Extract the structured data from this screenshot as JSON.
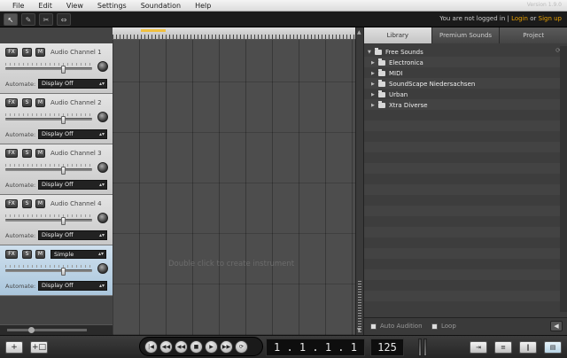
{
  "menu": {
    "items": [
      "File",
      "Edit",
      "View",
      "Settings",
      "Soundation",
      "Help"
    ],
    "version": "Version 1.9.0"
  },
  "toolbar": {
    "tools": [
      "pointer-tool-icon",
      "pencil-tool-icon",
      "split-tool-icon",
      "stretch-tool-icon"
    ],
    "login_text": "You are not logged in |",
    "login_link": "Login",
    "or_text": "or",
    "signup_link": "Sign up"
  },
  "channels": [
    {
      "fx": "FX",
      "solo": "S",
      "mute": "M",
      "name": "Audio Channel 1",
      "automate_label": "Automate:",
      "automate_value": "Display Off",
      "volume": 0.67
    },
    {
      "fx": "FX",
      "solo": "S",
      "mute": "M",
      "name": "Audio Channel 2",
      "automate_label": "Automate:",
      "automate_value": "Display Off",
      "volume": 0.67
    },
    {
      "fx": "FX",
      "solo": "S",
      "mute": "M",
      "name": "Audio Channel 3",
      "automate_label": "Automate:",
      "automate_value": "Display Off",
      "volume": 0.67
    },
    {
      "fx": "FX",
      "solo": "S",
      "mute": "M",
      "name": "Audio Channel 4",
      "automate_label": "Automate:",
      "automate_value": "Display Off",
      "volume": 0.67
    },
    {
      "fx": "FX",
      "solo": "S",
      "mute": "M",
      "preset": "Simple",
      "automate_label": "Automate:",
      "automate_value": "Display Off",
      "volume": 0.67,
      "selected": true
    }
  ],
  "timeline": {
    "hint": "Double click to create instrument"
  },
  "browser": {
    "tabs": [
      "Library",
      "Premium Sounds",
      "Project"
    ],
    "active_tab": "Library",
    "root": "Free Sounds",
    "folders": [
      "Electronica",
      "MIDI",
      "SoundScape Niedersachsen",
      "Urban",
      "Xtra Diverse"
    ],
    "auto_audition": "Auto Audition",
    "loop": "Loop"
  },
  "transport": {
    "position": "1 . 1 . 1 .",
    "position_tail": "1",
    "tempo": "125"
  },
  "colors": {
    "accent": "#e8a000",
    "selected_channel": "#aac6dc"
  }
}
